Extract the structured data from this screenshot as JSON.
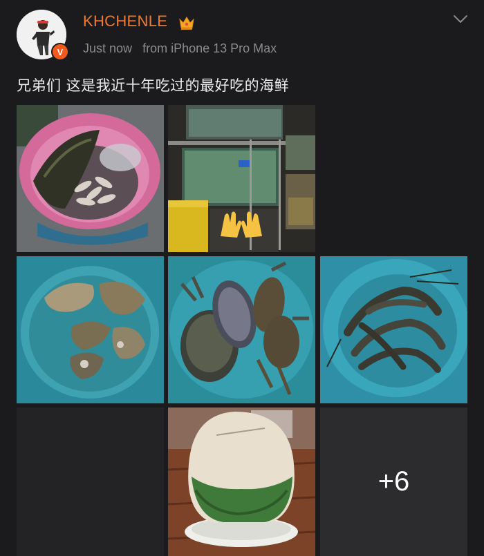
{
  "post": {
    "username": "KHCHENLE",
    "time": "Just now",
    "source": "from iPhone 13 Pro Max",
    "verified_mark": "V",
    "text": "兄弟们 这是我近十年吃过的最好吃的海鲜"
  },
  "media": {
    "more_label": "+6"
  },
  "icons": {
    "header": [
      "avatar",
      "crown-icon",
      "verified-badge-icon",
      "chevron-down-icon"
    ],
    "photo_overlay": "clapping-hands-icon"
  },
  "colors": {
    "username": "#f07a2e",
    "badge": "#f25a1f",
    "background": "#1b1b1d",
    "meta": "#8c8c8c"
  }
}
